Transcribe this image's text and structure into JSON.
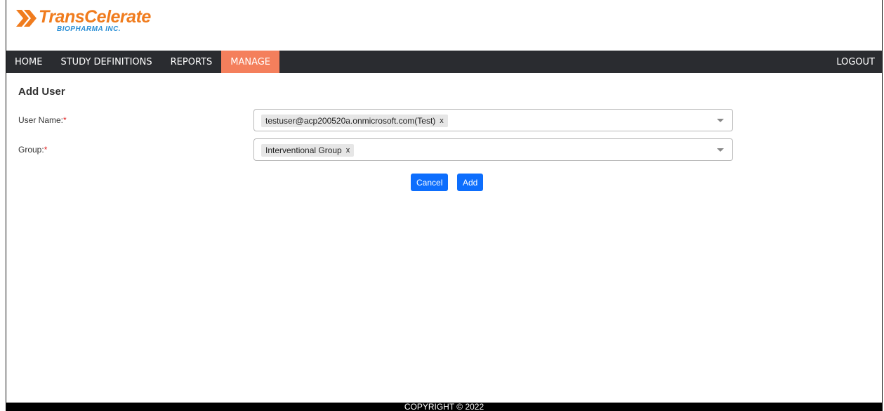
{
  "brand": {
    "title": "TransCelerate",
    "subtitle": "BIOPHARMA INC.",
    "primary_color": "#f07c1e",
    "secondary_color": "#2a8fd6",
    "icon": "double-chevron-right-icon"
  },
  "nav": {
    "items": [
      {
        "label": "HOME",
        "active": false
      },
      {
        "label": "STUDY DEFINITIONS",
        "active": false
      },
      {
        "label": "REPORTS",
        "active": false
      },
      {
        "label": "MANAGE",
        "active": true
      }
    ],
    "logout_label": "LOGOUT",
    "background_color": "#2a2c30",
    "active_color": "#f47f5c"
  },
  "page": {
    "title": "Add User"
  },
  "form": {
    "user_name": {
      "label": "User Name:",
      "required_mark": "*",
      "selected_value": "testuser@acp200520a.onmicrosoft.com(Test)",
      "remove_label": "x"
    },
    "group": {
      "label": "Group:",
      "required_mark": "*",
      "selected_value": "Interventional Group",
      "remove_label": "x"
    }
  },
  "actions": {
    "cancel_label": "Cancel",
    "add_label": "Add",
    "button_color": "#0d6efd"
  },
  "footer": {
    "text": "COPYRIGHT © 2022"
  }
}
